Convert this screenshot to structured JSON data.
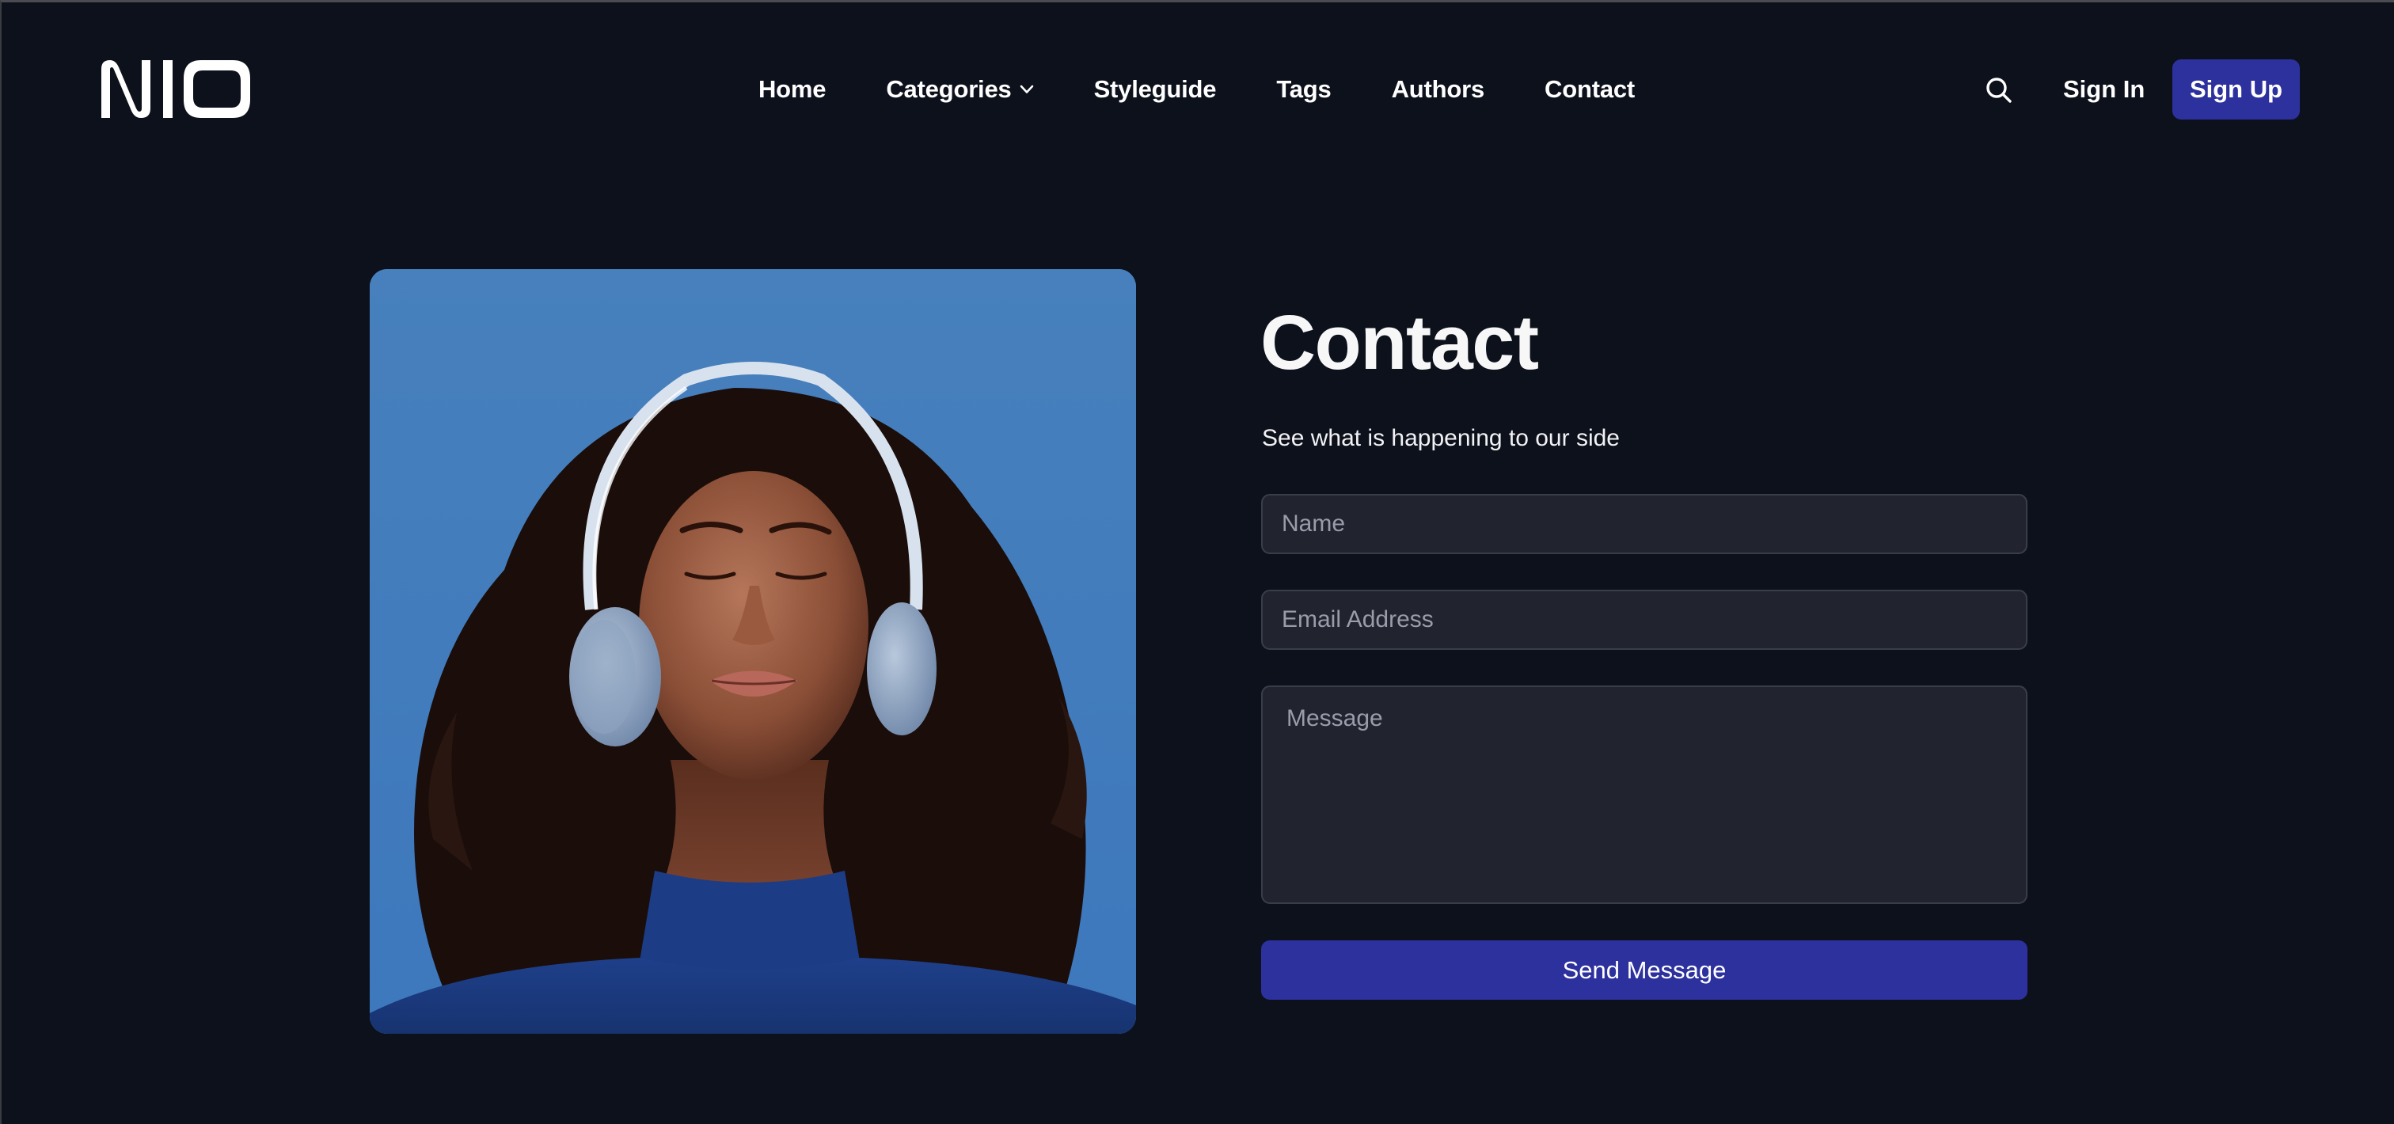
{
  "brand": {
    "logo_text": "NIO"
  },
  "nav": {
    "items": [
      {
        "label": "Home",
        "has_dropdown": false
      },
      {
        "label": "Categories",
        "has_dropdown": true
      },
      {
        "label": "Styleguide",
        "has_dropdown": false
      },
      {
        "label": "Tags",
        "has_dropdown": false
      },
      {
        "label": "Authors",
        "has_dropdown": false
      },
      {
        "label": "Contact",
        "has_dropdown": false
      }
    ]
  },
  "header_actions": {
    "search_icon": "search-icon",
    "sign_in_label": "Sign In",
    "sign_up_label": "Sign Up"
  },
  "hero_image": {
    "alt": "Woman with closed eyes wearing light blue headphones and a blue turtleneck against a blue sky"
  },
  "contact": {
    "title": "Contact",
    "subtitle": "See what is happening to our side",
    "form": {
      "name": {
        "value": "",
        "placeholder": "Name"
      },
      "email": {
        "value": "",
        "placeholder": "Email Address"
      },
      "message": {
        "value": "",
        "placeholder": "Message"
      },
      "submit_label": "Send Message"
    }
  },
  "colors": {
    "background": "#0d111c",
    "accent": "#2d319e",
    "input_bg": "#21242f",
    "input_border": "#393d4a",
    "placeholder": "#9a9caa",
    "text": "#ffffff"
  }
}
